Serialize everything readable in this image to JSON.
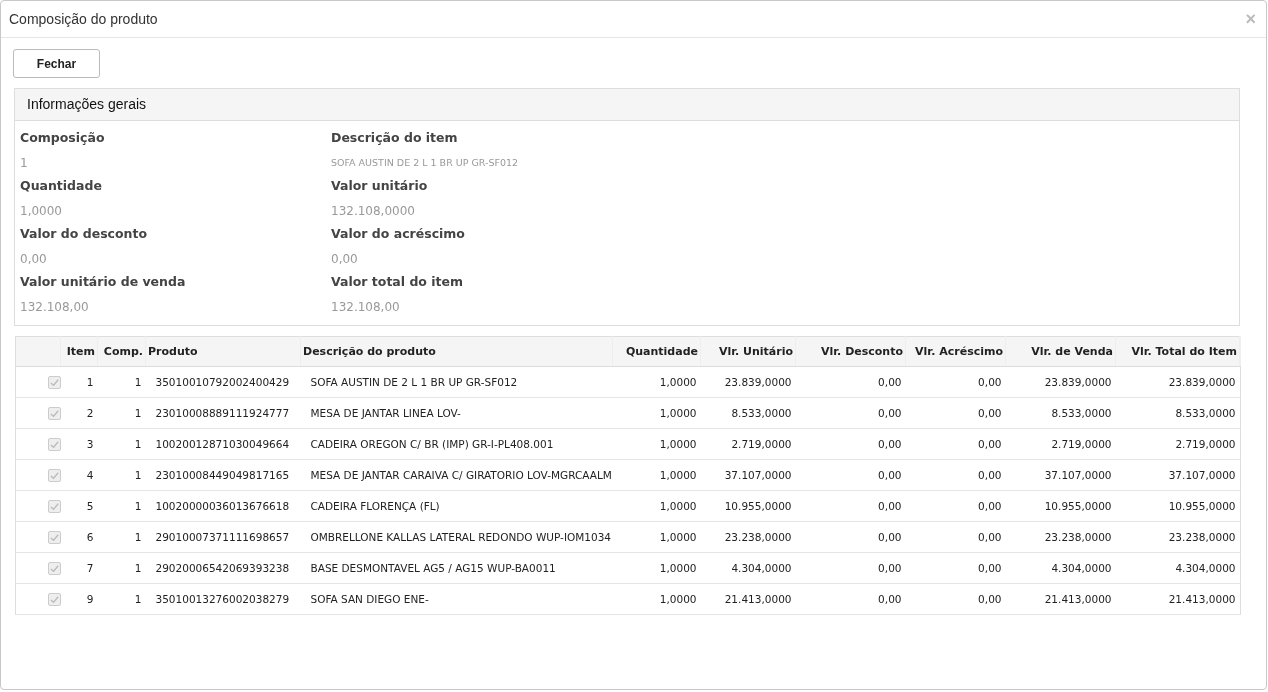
{
  "window": {
    "title": "Composição do produto",
    "close": "×"
  },
  "buttons": [
    "Fechar"
  ],
  "panel": {
    "title": "Informações gerais",
    "fields": [
      {
        "label": "Composição",
        "value": "1"
      },
      {
        "label": "Descrição do item",
        "value": "SOFA AUSTIN DE 2 L 1 BR UP GR-SF012",
        "kind": "small"
      },
      {
        "label": "Quantidade",
        "value": "1,0000"
      },
      {
        "label": "Valor unitário",
        "value": "132.108,0000"
      },
      {
        "label": "Valor do desconto",
        "value": "0,00"
      },
      {
        "label": "Valor do acréscimo",
        "value": "0,00"
      },
      {
        "label": "Valor unitário de venda",
        "value": "132.108,00"
      },
      {
        "label": "Valor total do item",
        "value": "132.108,00"
      }
    ]
  },
  "table": {
    "columns": [
      "Item",
      "Comp.",
      "Produto",
      "Descrição do produto",
      "Quantidade",
      "Vlr. Unitário",
      "Vlr. Desconto",
      "Vlr. Acréscimo",
      "Vlr. de Venda",
      "Vlr. Total do Item"
    ],
    "rows": [
      {
        "checked": true,
        "disabled": true,
        "cells": [
          "1",
          "1",
          "35010010792002400429",
          "SOFA AUSTIN DE 2 L 1 BR UP GR-SF012",
          "1,0000",
          "23.839,0000",
          "0,00",
          "0,00",
          "23.839,0000",
          "23.839,0000"
        ]
      },
      {
        "checked": true,
        "disabled": true,
        "cells": [
          "2",
          "1",
          "23010008889111924777",
          "MESA DE JANTAR LINEA LOV-",
          "1,0000",
          "8.533,0000",
          "0,00",
          "0,00",
          "8.533,0000",
          "8.533,0000"
        ]
      },
      {
        "checked": true,
        "disabled": true,
        "cells": [
          "3",
          "1",
          "10020012871030049664",
          "CADEIRA OREGON C/ BR (IMP) GR-I-PL408.001",
          "1,0000",
          "2.719,0000",
          "0,00",
          "0,00",
          "2.719,0000",
          "2.719,0000"
        ]
      },
      {
        "checked": true,
        "disabled": true,
        "cells": [
          "4",
          "1",
          "23010008449049817165",
          "MESA DE JANTAR CARAIVA C/ GIRATORIO LOV-MGRCAALM",
          "1,0000",
          "37.107,0000",
          "0,00",
          "0,00",
          "37.107,0000",
          "37.107,0000"
        ]
      },
      {
        "checked": true,
        "disabled": true,
        "cells": [
          "5",
          "1",
          "10020000036013676618",
          "CADEIRA FLORENÇA (FL)",
          "1,0000",
          "10.955,0000",
          "0,00",
          "0,00",
          "10.955,0000",
          "10.955,0000"
        ]
      },
      {
        "checked": true,
        "disabled": true,
        "cells": [
          "6",
          "1",
          "29010007371111698657",
          "OMBRELLONE KALLAS LATERAL REDONDO WUP-IOM1034",
          "1,0000",
          "23.238,0000",
          "0,00",
          "0,00",
          "23.238,0000",
          "23.238,0000"
        ]
      },
      {
        "checked": true,
        "disabled": true,
        "cells": [
          "7",
          "1",
          "29020006542069393238",
          "BASE DESMONTAVEL AG5 / AG15 WUP-BA0011",
          "1,0000",
          "4.304,0000",
          "0,00",
          "0,00",
          "4.304,0000",
          "4.304,0000"
        ]
      },
      {
        "checked": true,
        "disabled": true,
        "cells": [
          "9",
          "1",
          "35010013276002038279",
          "SOFA SAN DIEGO ENE-",
          "1,0000",
          "21.413,0000",
          "0,00",
          "0,00",
          "21.413,0000",
          "21.413,0000"
        ]
      }
    ]
  }
}
